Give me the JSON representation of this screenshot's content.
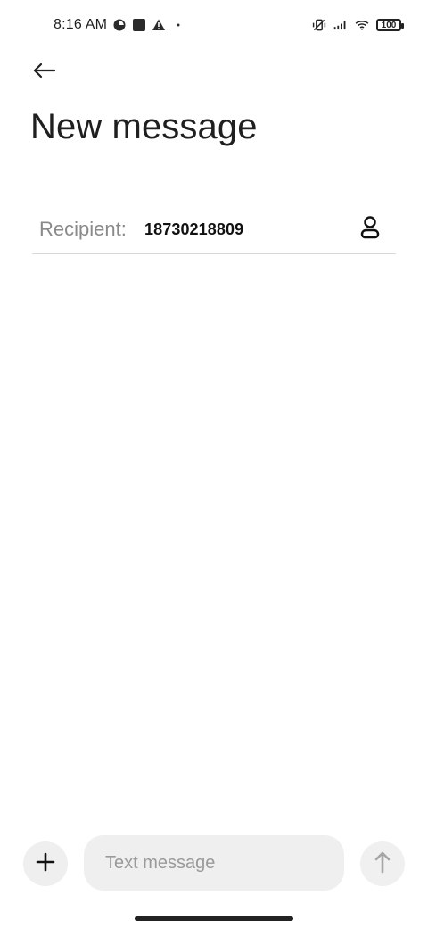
{
  "status_bar": {
    "time": "8:16 AM",
    "battery": "100",
    "icons": {
      "left": [
        "data-saver-icon",
        "stop-square-icon",
        "warning-icon",
        "dot-icon"
      ],
      "right": [
        "vibrate-off-icon",
        "signal-icon",
        "wifi-icon",
        "battery-icon"
      ]
    }
  },
  "header": {
    "back_icon": "arrow-left-icon",
    "title": "New message"
  },
  "recipient": {
    "label": "Recipient:",
    "value": "18730218809",
    "contact_icon": "contact-icon"
  },
  "composer": {
    "add_icon": "plus-icon",
    "placeholder": "Text message",
    "send_icon": "arrow-up-icon"
  },
  "colors": {
    "background": "#ffffff",
    "title": "#1f1f1f",
    "muted_text": "#8a8a8a",
    "input_bg": "#efefef",
    "divider": "#d8d8d8"
  }
}
